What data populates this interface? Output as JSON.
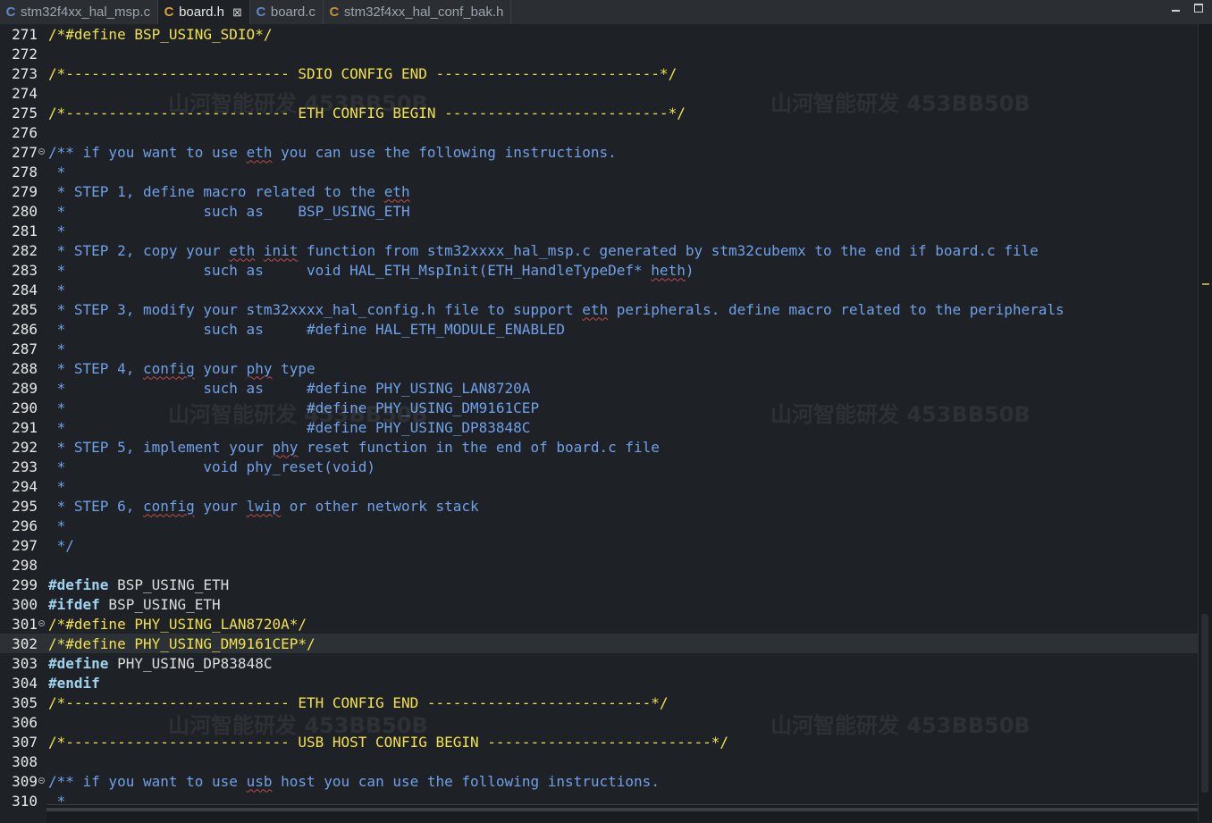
{
  "tabs": [
    {
      "icon": "C",
      "label": "stm32f4xx_hal_msp.c",
      "active": false,
      "icon_color": "#5f86c8"
    },
    {
      "icon": "C",
      "label": "board.h",
      "active": true,
      "icon_color": "#d6a03a",
      "close": "⊠"
    },
    {
      "icon": "C",
      "label": "board.c",
      "active": false,
      "icon_color": "#5f86c8"
    },
    {
      "icon": "C",
      "label": "stm32f4xx_hal_conf_bak.h",
      "active": false,
      "icon_color": "#c88f3a"
    }
  ],
  "watermark_text": "山河智能研发 453BB50B",
  "colors": {
    "background": "#1e2226",
    "comment_yellow": "#f2e14c",
    "comment_blue": "#6fa0e8",
    "keyword": "#9fd3f0"
  },
  "lines": [
    {
      "n": "271",
      "fold": false,
      "cur": false,
      "segs": [
        {
          "t": "/*#define BSP_USING_SDIO*/",
          "c": "c-yellow"
        }
      ]
    },
    {
      "n": "272",
      "fold": false,
      "cur": false,
      "segs": []
    },
    {
      "n": "273",
      "fold": false,
      "cur": false,
      "segs": [
        {
          "t": "/*-------------------------- SDIO CONFIG END --------------------------*/",
          "c": "c-yellow"
        }
      ]
    },
    {
      "n": "274",
      "fold": false,
      "cur": false,
      "segs": []
    },
    {
      "n": "275",
      "fold": false,
      "cur": false,
      "segs": [
        {
          "t": "/*-------------------------- ETH CONFIG BEGIN --------------------------*/",
          "c": "c-yellow"
        }
      ]
    },
    {
      "n": "276",
      "fold": false,
      "cur": false,
      "segs": []
    },
    {
      "n": "277",
      "fold": true,
      "cur": false,
      "segs": [
        {
          "t": "/** if you want to use ",
          "c": "c-cmt"
        },
        {
          "t": "eth",
          "c": "c-cmt sp"
        },
        {
          "t": " you can use the following instructions.",
          "c": "c-cmt"
        }
      ]
    },
    {
      "n": "278",
      "fold": false,
      "cur": false,
      "segs": [
        {
          "t": " *",
          "c": "c-cmt"
        }
      ]
    },
    {
      "n": "279",
      "fold": false,
      "cur": false,
      "segs": [
        {
          "t": " * STEP 1, define macro related to the ",
          "c": "c-cmt"
        },
        {
          "t": "eth",
          "c": "c-cmt sp"
        }
      ]
    },
    {
      "n": "280",
      "fold": false,
      "cur": false,
      "segs": [
        {
          "t": " *                such as    BSP_USING_ETH",
          "c": "c-cmt"
        }
      ]
    },
    {
      "n": "281",
      "fold": false,
      "cur": false,
      "segs": [
        {
          "t": " *",
          "c": "c-cmt"
        }
      ]
    },
    {
      "n": "282",
      "fold": false,
      "cur": false,
      "segs": [
        {
          "t": " * STEP 2, copy your ",
          "c": "c-cmt"
        },
        {
          "t": "eth",
          "c": "c-cmt sp"
        },
        {
          "t": " ",
          "c": "c-cmt"
        },
        {
          "t": "init",
          "c": "c-cmt sp"
        },
        {
          "t": " function from stm32xxxx_hal_msp.c generated by stm32cubemx to the end if board.c file",
          "c": "c-cmt"
        }
      ]
    },
    {
      "n": "283",
      "fold": false,
      "cur": false,
      "segs": [
        {
          "t": " *                such as     void HAL_ETH_MspInit(ETH_HandleTypeDef* ",
          "c": "c-cmt"
        },
        {
          "t": "heth",
          "c": "c-cmt sp"
        },
        {
          "t": ")",
          "c": "c-cmt"
        }
      ]
    },
    {
      "n": "284",
      "fold": false,
      "cur": false,
      "segs": [
        {
          "t": " *",
          "c": "c-cmt"
        }
      ]
    },
    {
      "n": "285",
      "fold": false,
      "cur": false,
      "segs": [
        {
          "t": " * STEP 3, modify your stm32xxxx_hal_config.h file to support ",
          "c": "c-cmt"
        },
        {
          "t": "eth",
          "c": "c-cmt sp"
        },
        {
          "t": " peripherals. define macro related to the peripherals",
          "c": "c-cmt"
        }
      ]
    },
    {
      "n": "286",
      "fold": false,
      "cur": false,
      "segs": [
        {
          "t": " *                such as     #define HAL_ETH_MODULE_ENABLED",
          "c": "c-cmt"
        }
      ]
    },
    {
      "n": "287",
      "fold": false,
      "cur": false,
      "segs": [
        {
          "t": " *",
          "c": "c-cmt"
        }
      ]
    },
    {
      "n": "288",
      "fold": false,
      "cur": false,
      "segs": [
        {
          "t": " * STEP 4, ",
          "c": "c-cmt"
        },
        {
          "t": "config",
          "c": "c-cmt sp"
        },
        {
          "t": " your ",
          "c": "c-cmt"
        },
        {
          "t": "phy",
          "c": "c-cmt sp"
        },
        {
          "t": " type",
          "c": "c-cmt"
        }
      ]
    },
    {
      "n": "289",
      "fold": false,
      "cur": false,
      "segs": [
        {
          "t": " *                such as     #define PHY_USING_LAN8720A",
          "c": "c-cmt"
        }
      ]
    },
    {
      "n": "290",
      "fold": false,
      "cur": false,
      "segs": [
        {
          "t": " *                            #define PHY_USING_DM9161CEP",
          "c": "c-cmt"
        }
      ]
    },
    {
      "n": "291",
      "fold": false,
      "cur": false,
      "segs": [
        {
          "t": " *                            #define PHY_USING_DP83848C",
          "c": "c-cmt"
        }
      ]
    },
    {
      "n": "292",
      "fold": false,
      "cur": false,
      "segs": [
        {
          "t": " * STEP 5, implement your ",
          "c": "c-cmt"
        },
        {
          "t": "phy",
          "c": "c-cmt sp"
        },
        {
          "t": " reset function in the end of board.c file",
          "c": "c-cmt"
        }
      ]
    },
    {
      "n": "293",
      "fold": false,
      "cur": false,
      "segs": [
        {
          "t": " *                void phy_reset(void)",
          "c": "c-cmt"
        }
      ]
    },
    {
      "n": "294",
      "fold": false,
      "cur": false,
      "segs": [
        {
          "t": " *",
          "c": "c-cmt"
        }
      ]
    },
    {
      "n": "295",
      "fold": false,
      "cur": false,
      "segs": [
        {
          "t": " * STEP 6, ",
          "c": "c-cmt"
        },
        {
          "t": "config",
          "c": "c-cmt sp"
        },
        {
          "t": " your ",
          "c": "c-cmt"
        },
        {
          "t": "lwip",
          "c": "c-cmt sp"
        },
        {
          "t": " or other network stack",
          "c": "c-cmt"
        }
      ]
    },
    {
      "n": "296",
      "fold": false,
      "cur": false,
      "segs": [
        {
          "t": " *",
          "c": "c-cmt"
        }
      ]
    },
    {
      "n": "297",
      "fold": false,
      "cur": false,
      "segs": [
        {
          "t": " */",
          "c": "c-cmt"
        }
      ]
    },
    {
      "n": "298",
      "fold": false,
      "cur": false,
      "segs": []
    },
    {
      "n": "299",
      "fold": false,
      "cur": false,
      "segs": [
        {
          "t": "#define",
          "c": "c-kw"
        },
        {
          "t": " BSP_USING_ETH",
          "c": "c-plain"
        }
      ]
    },
    {
      "n": "300",
      "fold": false,
      "cur": false,
      "segs": [
        {
          "t": "#ifdef",
          "c": "c-kw"
        },
        {
          "t": " BSP_USING_ETH",
          "c": "c-plain"
        }
      ]
    },
    {
      "n": "301",
      "fold": true,
      "cur": false,
      "segs": [
        {
          "t": "/*#define PHY_USING_LAN8720A*/",
          "c": "c-yellow"
        }
      ]
    },
    {
      "n": "302",
      "fold": false,
      "cur": true,
      "segs": [
        {
          "t": "/*#define PHY_USING_DM9161CEP*/",
          "c": "c-yellow"
        }
      ]
    },
    {
      "n": "303",
      "fold": false,
      "cur": false,
      "segs": [
        {
          "t": "#define",
          "c": "c-kw"
        },
        {
          "t": " PHY_USING_DP83848C",
          "c": "c-plain"
        }
      ]
    },
    {
      "n": "304",
      "fold": false,
      "cur": false,
      "segs": [
        {
          "t": "#endif",
          "c": "c-kw"
        }
      ]
    },
    {
      "n": "305",
      "fold": false,
      "cur": false,
      "segs": [
        {
          "t": "/*-------------------------- ETH CONFIG END --------------------------*/",
          "c": "c-yellow"
        }
      ]
    },
    {
      "n": "306",
      "fold": false,
      "cur": false,
      "segs": []
    },
    {
      "n": "307",
      "fold": false,
      "cur": false,
      "segs": [
        {
          "t": "/*-------------------------- USB HOST CONFIG BEGIN --------------------------*/",
          "c": "c-yellow"
        }
      ]
    },
    {
      "n": "308",
      "fold": false,
      "cur": false,
      "segs": []
    },
    {
      "n": "309",
      "fold": true,
      "cur": false,
      "segs": [
        {
          "t": "/** if you want to use ",
          "c": "c-cmt"
        },
        {
          "t": "usb",
          "c": "c-cmt sp"
        },
        {
          "t": " host you can use the following instructions.",
          "c": "c-cmt"
        }
      ]
    },
    {
      "n": "310",
      "fold": false,
      "cur": false,
      "segs": [
        {
          "t": " *",
          "c": "c-cmt"
        }
      ]
    }
  ]
}
